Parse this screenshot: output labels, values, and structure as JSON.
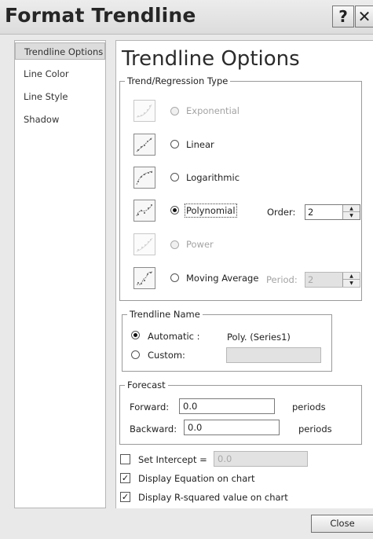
{
  "window": {
    "title": "Format Trendline",
    "help_label": "?",
    "close_label": "✕"
  },
  "sidebar": {
    "items": [
      {
        "label": "Trendline Options",
        "active": true
      },
      {
        "label": "Line Color"
      },
      {
        "label": "Line Style"
      },
      {
        "label": "Shadow"
      }
    ]
  },
  "main": {
    "title": "Trendline Options",
    "trend_type": {
      "legend": "Trend/Regression Type",
      "options": [
        {
          "label": "Exponential",
          "access_key": "x",
          "enabled": false,
          "selected": false,
          "icon": "exponential-trend-icon"
        },
        {
          "label": "Linear",
          "access_key": "L",
          "enabled": true,
          "selected": false,
          "icon": "linear-trend-icon"
        },
        {
          "label": "Logarithmic",
          "access_key": "o",
          "enabled": true,
          "selected": false,
          "icon": "logarithmic-trend-icon"
        },
        {
          "label": "Polynomial",
          "access_key": "P",
          "enabled": true,
          "selected": true,
          "icon": "polynomial-trend-icon"
        },
        {
          "label": "Power",
          "access_key": "w",
          "enabled": false,
          "selected": false,
          "icon": "power-trend-icon"
        },
        {
          "label": "Moving Average",
          "access_key": "M",
          "enabled": true,
          "selected": false,
          "icon": "moving-average-trend-icon"
        }
      ],
      "order_label": "Order:",
      "order_value": "2",
      "period_label": "Period:",
      "period_value": "2"
    },
    "trendline_name": {
      "legend": "Trendline Name",
      "automatic_label": "Automatic :",
      "automatic_value": "Poly. (Series1)",
      "custom_label": "Custom:",
      "custom_value": "",
      "selected": "automatic"
    },
    "forecast": {
      "legend": "Forecast",
      "forward_label": "Forward:",
      "forward_value": "0.0",
      "forward_unit": "periods",
      "backward_label": "Backward:",
      "backward_value": "0.0",
      "backward_unit": "periods"
    },
    "set_intercept": {
      "label": "Set Intercept =",
      "checked": false,
      "value": "0.0"
    },
    "display_equation": {
      "label": "Display Equation on chart",
      "checked": true
    },
    "display_r_squared": {
      "label": "Display R-squared value on chart",
      "checked": true
    }
  },
  "footer": {
    "close_button": "Close"
  },
  "colors": {
    "selected_sidebar": "#dcdcdc",
    "frame": "#e9e9e9",
    "disabled_text": "#a3a3a3"
  }
}
